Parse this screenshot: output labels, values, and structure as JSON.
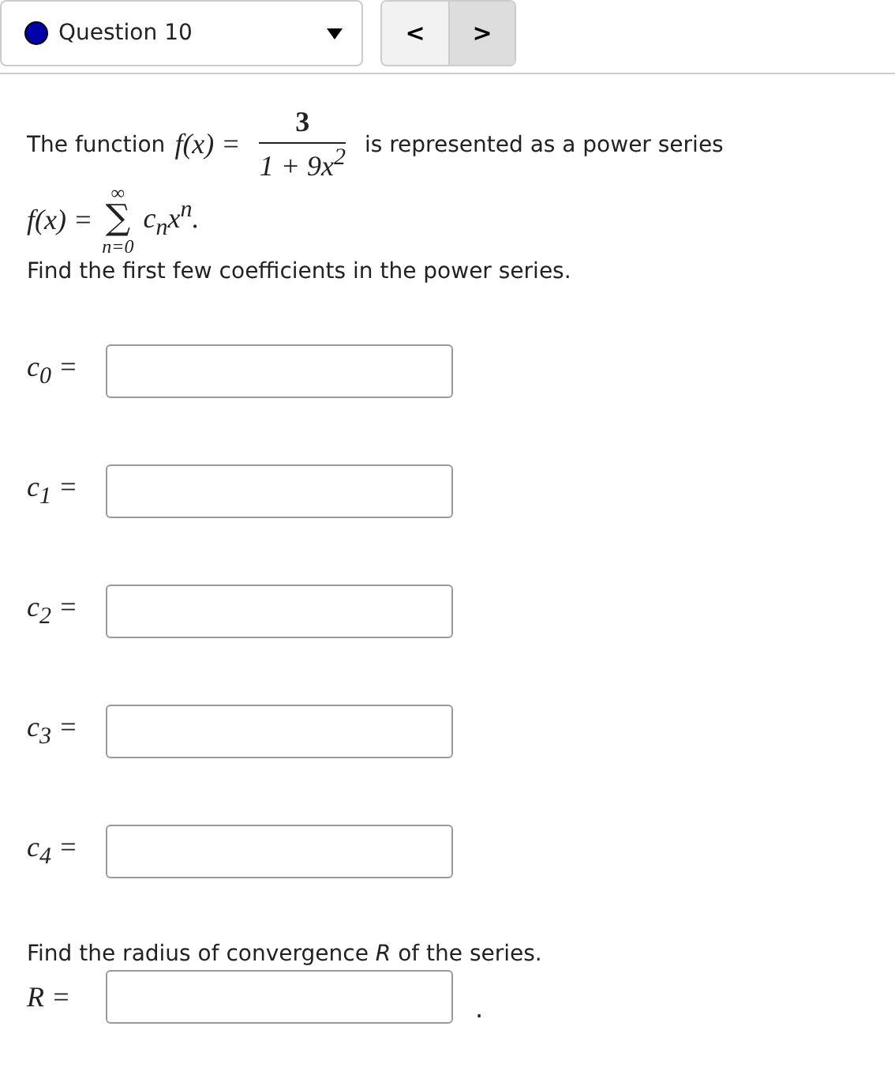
{
  "header": {
    "question_label": "Question 10",
    "prev_label": "<",
    "next_label": ">"
  },
  "intro": {
    "lead": "The function",
    "lhs": "f(x) =",
    "numerator": "3",
    "denominator": "1 + 9x$^{2}$",
    "trail": "is represented as a power series"
  },
  "series": {
    "lhs": "f(x) =",
    "sigma": "∑",
    "upper": "∞",
    "lower": "n=0",
    "term": "c$_{n}$x$^{n}$."
  },
  "instruction": "Find the first few coefficients in the power series.",
  "coefficients": [
    {
      "label": "c$_{0}$ ="
    },
    {
      "label": "c$_{1}$ ="
    },
    {
      "label": "c$_{2}$ ="
    },
    {
      "label": "c$_{3}$ ="
    },
    {
      "label": "c$_{4}$ ="
    }
  ],
  "radius": {
    "prompt": "Find the radius of convergence *R* of the series.",
    "label": "R =",
    "after": "."
  }
}
